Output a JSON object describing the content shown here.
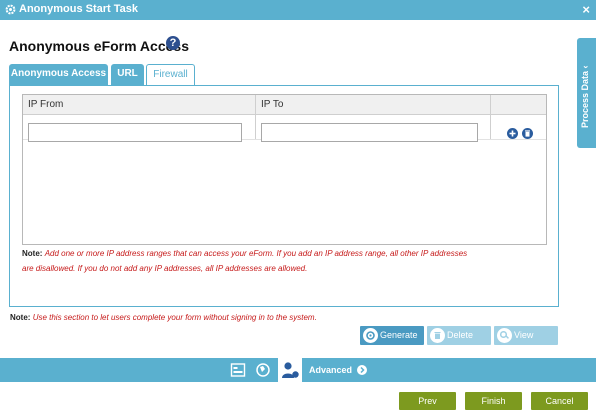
{
  "titlebar": {
    "title": "Anonymous Start Task",
    "close_label": "×"
  },
  "heading": "Anonymous eForm Access",
  "help_icon_label": "?",
  "tabs": [
    {
      "label": "Anonymous Access",
      "active": true
    },
    {
      "label": "URL",
      "active": true
    },
    {
      "label": "Firewall",
      "active": false
    }
  ],
  "grid": {
    "columns": [
      "IP From",
      "IP To"
    ],
    "rows": [
      {
        "ip_from": "",
        "ip_to": ""
      }
    ]
  },
  "notes": {
    "firewall_label": "Note:",
    "firewall_line1": "Add one or more IP address ranges that can access your eForm. If you add an IP address range, all other IP addresses",
    "firewall_line2": "are disallowed. If you do not add any IP addresses, all IP addresses are allowed.",
    "section_label": "Note:",
    "section_text": "Use this section to let users complete your form without signing in to the system."
  },
  "buttons": {
    "generate": "Generate",
    "delete": "Delete",
    "view": "View"
  },
  "bottombar": {
    "advanced_label": "Advanced"
  },
  "nav": {
    "prev": "Prev",
    "finish": "Finish",
    "cancel": "Cancel"
  },
  "side_panel": {
    "label": "Process Data ‹"
  },
  "colors": {
    "accent": "#5ab0cf",
    "nav_button": "#7d9a1f",
    "note_text": "#c61a1a",
    "icon_blue": "#2a5c9e"
  }
}
